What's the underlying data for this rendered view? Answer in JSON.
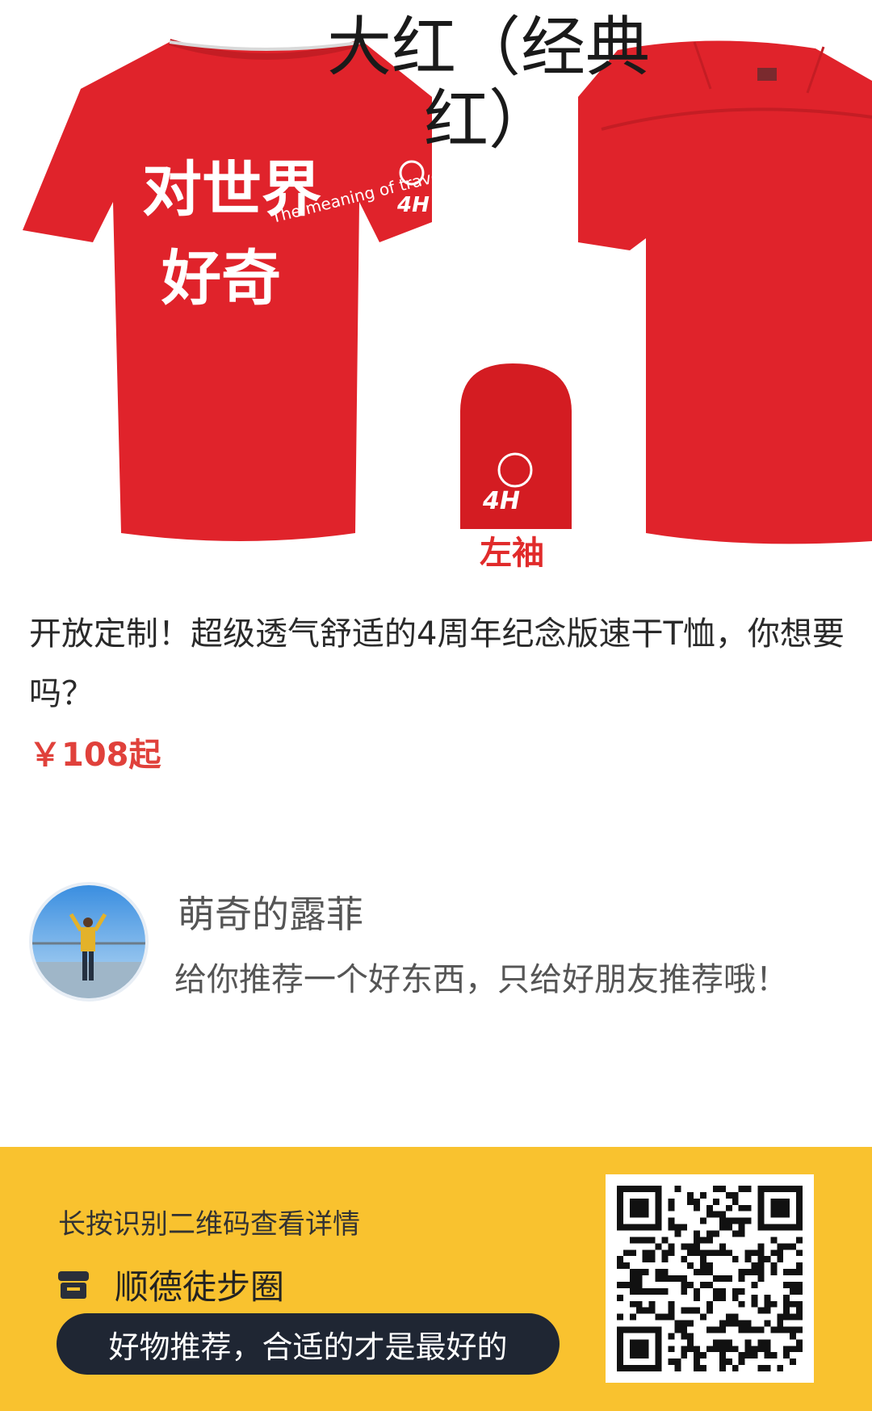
{
  "product": {
    "color_label": "大红（经典红）",
    "sleeve_caption": "左袖",
    "title": "开放定制！超级透气舒适的4周年纪念版速干T恤，你想要吗？",
    "price": "￥108起",
    "print_text": "对世界好奇",
    "print_text_en": "The meaning of travel",
    "anniversary_mark": "4H",
    "colors": {
      "shirt": "#e0232b",
      "price": "#e0413b"
    }
  },
  "recommender": {
    "name": "萌奇的露菲",
    "message": "给你推荐一个好东西，只给好朋友推荐哦！",
    "avatar_icon": "person-on-balcony-avatar"
  },
  "footer": {
    "hint": "长按识别二维码查看详情",
    "shop_icon": "store-icon",
    "shop_name": "顺德徒步圈",
    "slogan": "好物推荐，合适的才是最好的",
    "qr_icon": "qr-code",
    "colors": {
      "background": "#f9c22f",
      "pill": "#1f2633"
    }
  }
}
